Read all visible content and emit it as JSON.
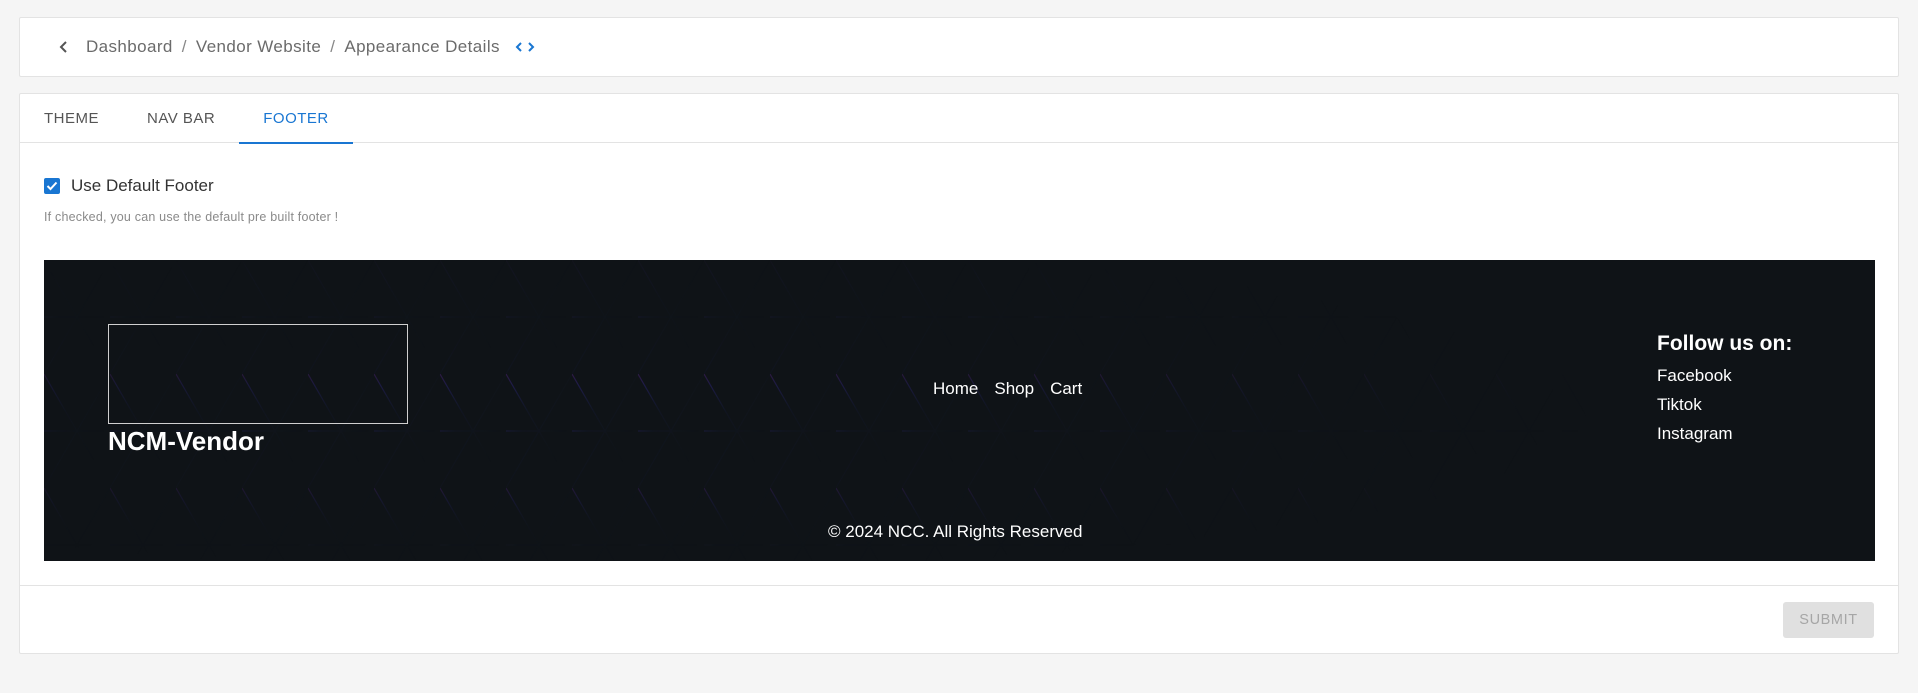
{
  "breadcrumb": {
    "items": [
      "Dashboard",
      "Vendor Website",
      "Appearance Details"
    ],
    "separator": "/"
  },
  "tabs": [
    {
      "label": "THEME",
      "active": false
    },
    {
      "label": "NAV BAR",
      "active": false
    },
    {
      "label": "FOOTER",
      "active": true
    }
  ],
  "footer_settings": {
    "use_default_label": "Use Default Footer",
    "use_default_checked": true,
    "helper_text": "If checked, you can use the default pre built footer !"
  },
  "preview": {
    "brand": "NCM-Vendor",
    "nav_links": [
      "Home",
      "Shop",
      "Cart"
    ],
    "follow_title": "Follow us on:",
    "social_links": [
      "Facebook",
      "Tiktok",
      "Instagram"
    ],
    "copyright": "© 2024 NCC. All Rights Reserved"
  },
  "actions": {
    "submit_label": "SUBMIT"
  },
  "colors": {
    "accent": "#1976d2",
    "footer_background": "#0f1317"
  },
  "icons": {
    "back": "chevron-left-icon",
    "code": "code-icon",
    "checkbox": "check-icon"
  }
}
